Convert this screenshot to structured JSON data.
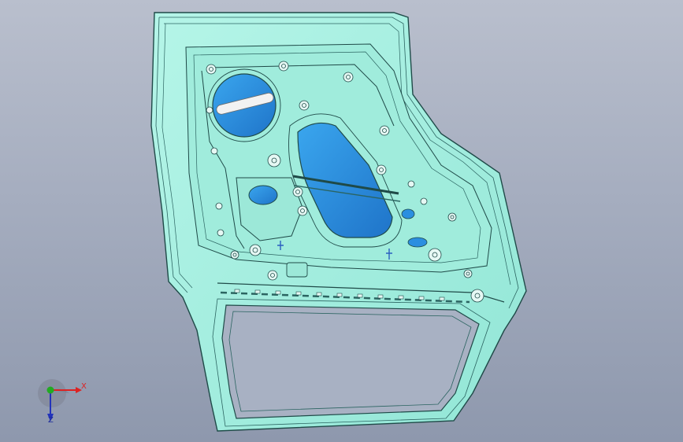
{
  "viewport": {
    "background_top": "#b9bfcd",
    "background_bottom": "#8e98ad"
  },
  "model": {
    "part": "door-inner-panel",
    "face_color": "#a6efe0",
    "edge_color": "#1f4a48",
    "pocket_color": "#2b8fe0",
    "boss_color": "#e6f8f4"
  },
  "triad": {
    "x_label": "X",
    "z_label": "Z",
    "x_color": "#dd2222",
    "y_color": "#22aa22",
    "z_color": "#2233bb"
  }
}
